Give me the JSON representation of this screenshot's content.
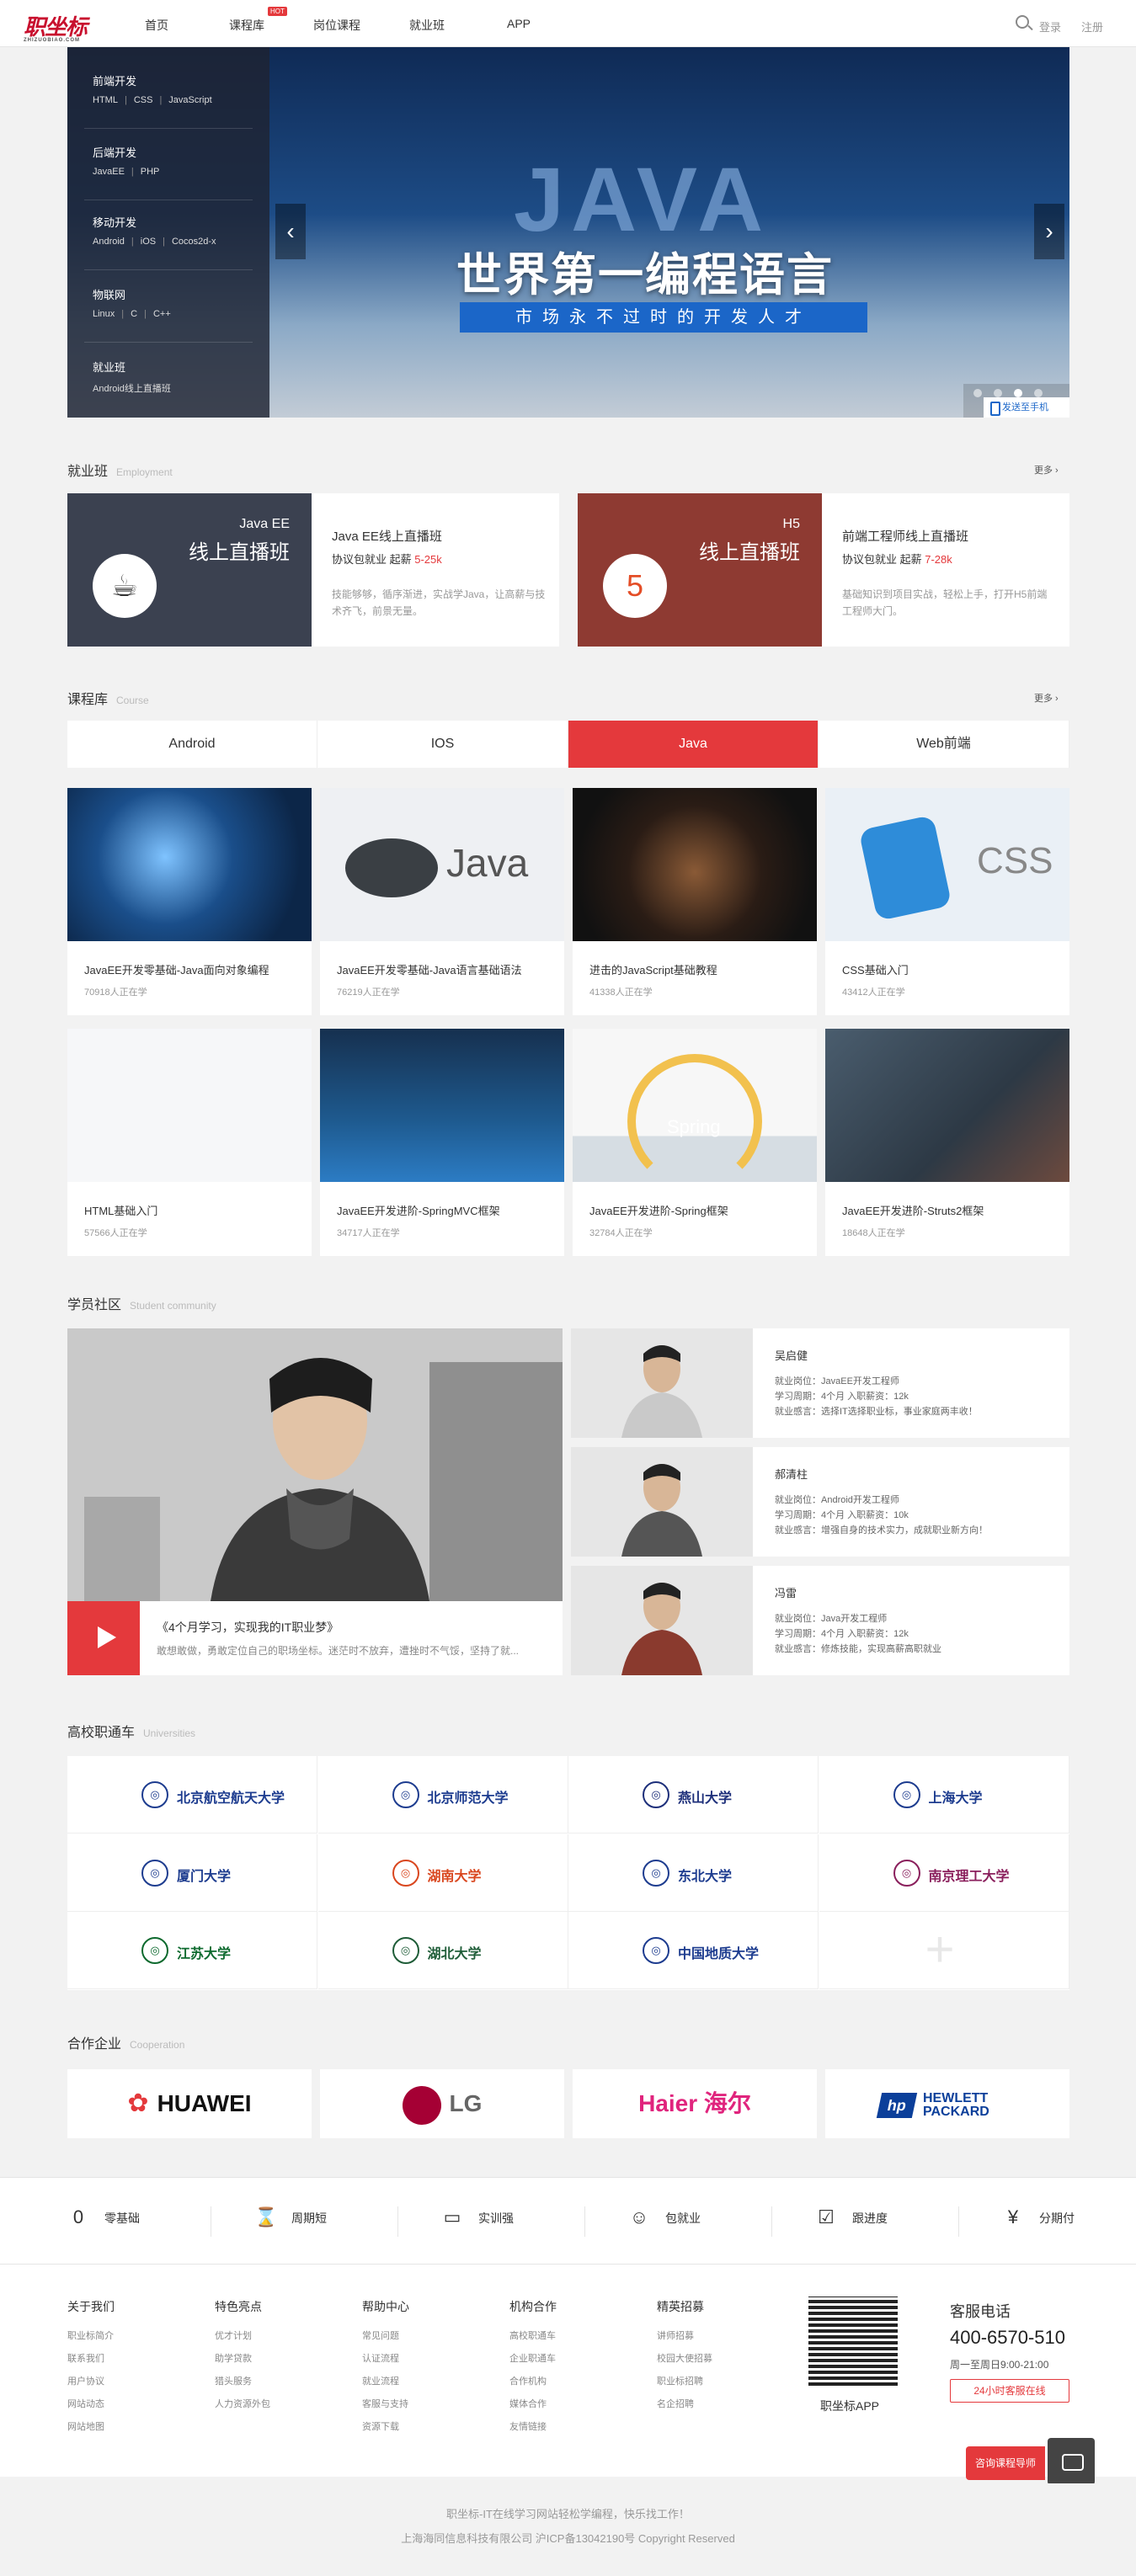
{
  "header": {
    "logo": "职坐标",
    "logo_sub": "ZHIZUOBIAO.COM",
    "nav": [
      "首页",
      "课程库",
      "岗位课程",
      "就业班",
      "APP"
    ],
    "hot_badge": "HOT",
    "login": "登录",
    "register": "注册"
  },
  "banner": {
    "menu": [
      {
        "title": "前端开发",
        "items": [
          "HTML",
          "CSS",
          "JavaScript"
        ]
      },
      {
        "title": "后端开发",
        "items": [
          "JavaEE",
          "PHP"
        ]
      },
      {
        "title": "移动开发",
        "items": [
          "Android",
          "iOS",
          "Cocos2d-x"
        ]
      },
      {
        "title": "物联网",
        "items": [
          "Linux",
          "C",
          "C++"
        ]
      },
      {
        "title": "就业班",
        "items": [
          "Android线上直播班"
        ]
      }
    ],
    "big_word": "JAVA",
    "slogan": "世界第一编程语言",
    "slogan_sub": "市场永不过时的开发人才",
    "send_to_phone": "发送至手机",
    "prev": "‹",
    "next": "›"
  },
  "employment": {
    "title": "就业班",
    "title_en": "Employment",
    "more": "更多 ›",
    "cards": [
      {
        "img_t1": "Java EE",
        "img_t2": "线上直播班",
        "name": "Java EE线上直播班",
        "info_prefix": "协议包就业 起薪 ",
        "salary": "5-25k",
        "desc": "技能够够，循序渐进，实战学Java，让高薪与技术齐飞，前景无量。",
        "color": "#3b4150"
      },
      {
        "img_t1": "H5",
        "img_t2": "线上直播班",
        "name": "前端工程师线上直播班",
        "info_prefix": "协议包就业 起薪 ",
        "salary": "7-28k",
        "desc": "基础知识到项目实战，轻松上手，打开H5前端工程师大门。",
        "color": "#8e3a32"
      }
    ]
  },
  "courses": {
    "title": "课程库",
    "title_en": "Course",
    "more": "更多 ›",
    "tabs": [
      "Android",
      "IOS",
      "Java",
      "Web前端"
    ],
    "active_tab": "Java",
    "items": [
      {
        "name": "JavaEE开发零基础-Java面向对象编程",
        "count": "70918人正在学"
      },
      {
        "name": "JavaEE开发零基础-Java语言基础语法",
        "count": "76219人正在学",
        "img_text": "Java"
      },
      {
        "name": "进击的JavaScript基础教程",
        "count": "41338人正在学"
      },
      {
        "name": "CSS基础入门",
        "count": "43412人正在学",
        "img_text": "CSS"
      },
      {
        "name": "HTML基础入门",
        "count": "57566人正在学"
      },
      {
        "name": "JavaEE开发进阶-SpringMVC框架",
        "count": "34717人正在学"
      },
      {
        "name": "JavaEE开发进阶-Spring框架",
        "count": "32784人正在学",
        "img_text": "Spring"
      },
      {
        "name": "JavaEE开发进阶-Struts2框架",
        "count": "18648人正在学"
      }
    ]
  },
  "community": {
    "title": "学员社区",
    "title_en": "Student community",
    "feature": {
      "title": "《4个月学习，实现我的IT职业梦》",
      "desc": "敢想敢做，勇敢定位自己的职场坐标。迷茫时不放弃，遭挫时不气馁，坚持了就..."
    },
    "students": [
      {
        "name": "吴启健",
        "pos": "就业岗位：JavaEE开发工程师",
        "period": "学习周期：4个月 入职薪资：12k",
        "quote": "就业感言：选择IT选择职业标，事业家庭两丰收！"
      },
      {
        "name": "郝清柱",
        "pos": "就业岗位：Android开发工程师",
        "period": "学习周期：4个月 入职薪资：10k",
        "quote": "就业感言：增强自身的技术实力，成就职业新方向！"
      },
      {
        "name": "冯雷",
        "pos": "就业岗位：Java开发工程师",
        "period": "学习周期：4个月 入职薪资：12k",
        "quote": "就业感言：修炼技能，实现高薪高职就业"
      }
    ]
  },
  "universities": {
    "title": "高校职通车",
    "title_en": "Universities",
    "items": [
      {
        "name": "北京航空航天大学",
        "color": "#1d3c8f"
      },
      {
        "name": "北京师范大学",
        "color": "#1d3c8f"
      },
      {
        "name": "燕山大学",
        "color": "#1d2f7a"
      },
      {
        "name": "上海大学",
        "color": "#1d3c8f"
      },
      {
        "name": "厦门大学",
        "color": "#1d3c8f"
      },
      {
        "name": "湖南大学",
        "color": "#d9461e"
      },
      {
        "name": "东北大学",
        "color": "#1d3c8f"
      },
      {
        "name": "南京理工大学",
        "color": "#8a1f5c"
      },
      {
        "name": "江苏大学",
        "color": "#0d6a2e"
      },
      {
        "name": "湖北大学",
        "color": "#1f5d38"
      },
      {
        "name": "中国地质大学",
        "color": "#1d3c8f"
      }
    ]
  },
  "cooperation": {
    "title": "合作企业",
    "title_en": "Cooperation",
    "items": [
      {
        "name": "HUAWEI",
        "color": "#111"
      },
      {
        "name": "LG",
        "color": "#666"
      },
      {
        "name": "Haier 海尔",
        "color": "#e0247d"
      },
      {
        "name": "HEWLETT PACKARD",
        "color": "#0b3f9a"
      }
    ]
  },
  "features": [
    {
      "label": "零基础",
      "icon": "zero-icon",
      "glyph": "0"
    },
    {
      "label": "周期短",
      "icon": "hourglass-icon",
      "glyph": "⌛"
    },
    {
      "label": "实训强",
      "icon": "monitor-icon",
      "glyph": "▭"
    },
    {
      "label": "包就业",
      "icon": "person-icon",
      "glyph": "☺"
    },
    {
      "label": "跟进度",
      "icon": "calendar-icon",
      "glyph": "☑"
    },
    {
      "label": "分期付",
      "icon": "yen-icon",
      "glyph": "¥"
    }
  ],
  "footer": {
    "columns": [
      {
        "title": "关于我们",
        "items": [
          "职业标简介",
          "联系我们",
          "用户协议",
          "网站动态",
          "网站地图"
        ]
      },
      {
        "title": "特色亮点",
        "items": [
          "优才计划",
          "助学贷款",
          "猎头服务",
          "人力资源外包"
        ]
      },
      {
        "title": "帮助中心",
        "items": [
          "常见问题",
          "认证流程",
          "就业流程",
          "客服与支持",
          "资源下载"
        ]
      },
      {
        "title": "机构合作",
        "items": [
          "高校职通车",
          "企业职通车",
          "合作机构",
          "媒体合作",
          "友情链接"
        ]
      },
      {
        "title": "精英招募",
        "items": [
          "讲师招募",
          "校园大使招募",
          "职业标招聘",
          "名企招聘"
        ]
      }
    ],
    "qr_label": "职坐标APP",
    "cs_title": "客服电话",
    "cs_phone": "400-6570-510",
    "cs_hours": "周一至周日9:00-21:00",
    "cs_online": "24小时客服在线",
    "consult_label": "咨询课程导师",
    "copyright1": "职坐标-IT在线学习网站轻松学编程，快乐找工作！",
    "copyright2": "上海海同信息科技有限公司 沪ICP备13042190号 Copyright Reserved"
  }
}
